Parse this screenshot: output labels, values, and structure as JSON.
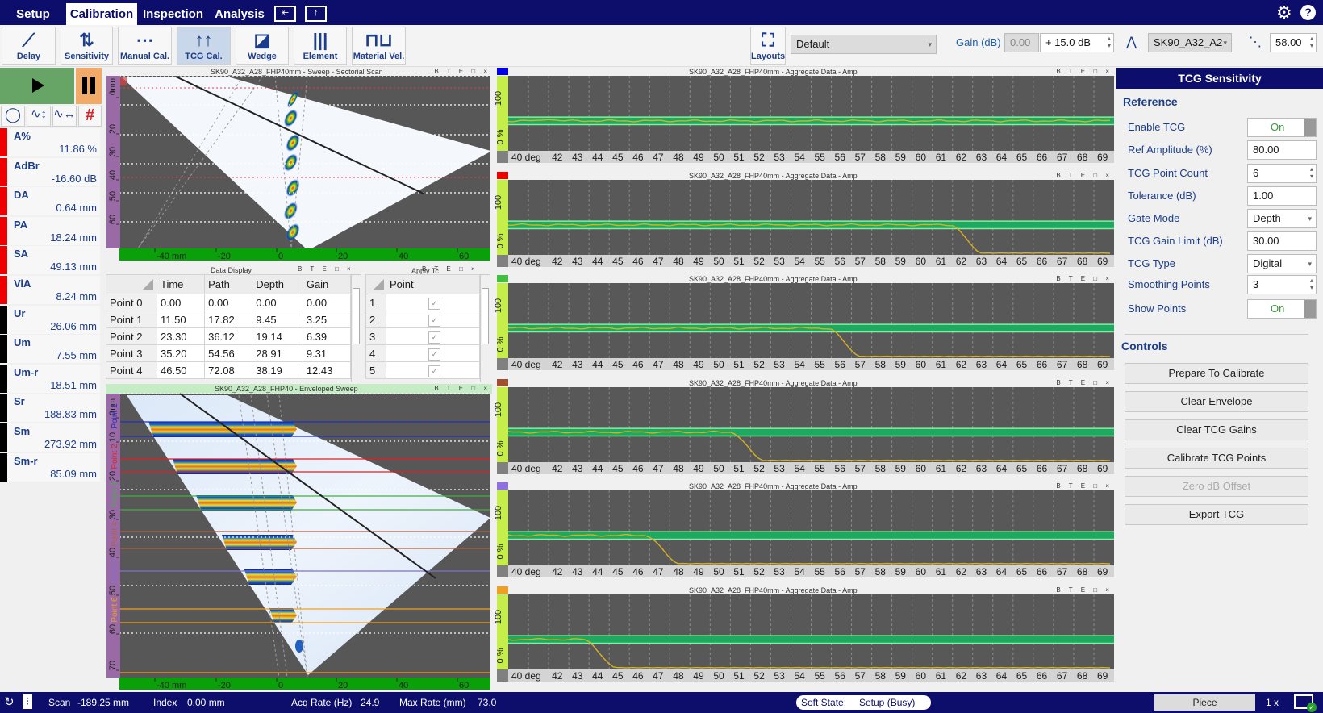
{
  "menu": {
    "tabs": [
      "Setup",
      "Calibration",
      "Inspection",
      "Analysis"
    ],
    "selected": "Calibration",
    "icons": [
      "panel-left-icon",
      "panel-up-icon"
    ]
  },
  "toolbar": {
    "buttons": [
      {
        "label": "Delay",
        "icon": "delay-icon"
      },
      {
        "label": "Sensitivity",
        "icon": "sensitivity-icon"
      },
      {
        "label": "Manual Cal.",
        "icon": "manual-cal-icon"
      },
      {
        "label": "TCG Cal.",
        "icon": "tcg-cal-icon",
        "selected": true
      },
      {
        "label": "Wedge",
        "icon": "wedge-icon"
      },
      {
        "label": "Element",
        "icon": "element-icon"
      },
      {
        "label": "Material Vel.",
        "icon": "material-vel-icon"
      }
    ],
    "layouts_label": "Layouts",
    "layout_value": "Default",
    "gain_label": "Gain (dB)",
    "gain_base": "0.00",
    "gain_offset": "+ 15.0 dB",
    "probe_value": "SK90_A32_A2",
    "angle_value": "58.00"
  },
  "readings": [
    {
      "name": "A%",
      "value": "11.86 %",
      "color": "#ee0000"
    },
    {
      "name": "AdBr",
      "value": "-16.60 dB",
      "color": "#ee0000"
    },
    {
      "name": "DA",
      "value": "0.64 mm",
      "color": "#ee0000"
    },
    {
      "name": "PA",
      "value": "18.24 mm",
      "color": "#ee0000"
    },
    {
      "name": "SA",
      "value": "49.13 mm",
      "color": "#ee0000"
    },
    {
      "name": "ViA",
      "value": "8.24 mm",
      "color": "#ee0000"
    },
    {
      "name": "Ur",
      "value": "26.06 mm",
      "color": "#000000"
    },
    {
      "name": "Um",
      "value": "7.55 mm",
      "color": "#000000"
    },
    {
      "name": "Um-r",
      "value": "-18.51 mm",
      "color": "#000000"
    },
    {
      "name": "Sr",
      "value": "188.83 mm",
      "color": "#000000"
    },
    {
      "name": "Sm",
      "value": "273.92 mm",
      "color": "#000000"
    },
    {
      "name": "Sm-r",
      "value": "85.09 mm",
      "color": "#000000"
    }
  ],
  "window_controls": "B T E □ ×",
  "sector_scan": {
    "title": "SK90_A32_A28_FHP40mm - Sweep - Sectorial Scan",
    "depth_unit": "mm",
    "depth_ticks": [
      "0",
      "20",
      "30",
      "40",
      "50",
      "60"
    ],
    "x_ticks": [
      "-40 mm",
      "-20",
      "0",
      "20",
      "40",
      "60"
    ]
  },
  "envelope_scan": {
    "title": "SK90_A32_A28_FHP40 - Enveloped Sweep",
    "depth_unit": "mm",
    "depth_ticks": [
      "0",
      "10",
      "20",
      "30",
      "40",
      "50",
      "60",
      "70"
    ],
    "x_ticks": [
      "-40 mm",
      "-20",
      "0",
      "20",
      "40",
      "60"
    ],
    "points": [
      {
        "label": "Point 1",
        "color": "#2030c0"
      },
      {
        "label": "Point 2",
        "color": "#e02020"
      },
      {
        "label": "Point 3",
        "color": "#40b040"
      },
      {
        "label": "Point 4",
        "color": "#b06040"
      },
      {
        "label": "Point 5",
        "color": "#8070d0"
      },
      {
        "label": "Point 6",
        "color": "#f0a020"
      }
    ]
  },
  "data_display": {
    "title": "Data Display",
    "columns": [
      "Time",
      "Path",
      "Depth",
      "Gain"
    ],
    "rows": [
      {
        "name": "Point 0",
        "values": [
          "0.00",
          "0.00",
          "0.00",
          "0.00"
        ]
      },
      {
        "name": "Point 1",
        "values": [
          "11.50",
          "17.82",
          "9.45",
          "3.25"
        ]
      },
      {
        "name": "Point 2",
        "values": [
          "23.30",
          "36.12",
          "19.14",
          "6.39"
        ]
      },
      {
        "name": "Point 3",
        "values": [
          "35.20",
          "54.56",
          "28.91",
          "9.31"
        ]
      },
      {
        "name": "Point 4",
        "values": [
          "46.50",
          "72.08",
          "38.19",
          "12.43"
        ]
      }
    ]
  },
  "apply_tcg": {
    "title": "Apply Tc",
    "column": "Point",
    "rows": [
      {
        "n": "1",
        "checked": true
      },
      {
        "n": "2",
        "checked": true
      },
      {
        "n": "3",
        "checked": true
      },
      {
        "n": "4",
        "checked": true
      },
      {
        "n": "5",
        "checked": true
      }
    ]
  },
  "a_scans": {
    "title": "SK90_A32_A28_FHP40mm - Aggregate Data - Amp",
    "y_top_label": "100",
    "y_bottom_label": "0 %",
    "x_first_label": "40 deg",
    "angle_range": [
      40,
      70
    ],
    "x_labels": [
      42,
      43,
      44,
      45,
      46,
      47,
      48,
      49,
      50,
      51,
      52,
      53,
      54,
      55,
      56,
      57,
      58,
      59,
      60,
      61,
      62,
      63,
      64,
      65,
      66,
      67,
      68,
      69
    ],
    "band_percent": [
      35,
      45
    ],
    "plateau_percent": 40,
    "floor_percent": 2,
    "plots": [
      {
        "color": "#0000ee",
        "drop_start": null,
        "drop_end": null
      },
      {
        "color": "#ee0000",
        "drop_start": 61.9,
        "drop_end": 63.5
      },
      {
        "color": "#40c040",
        "drop_start": 55.8,
        "drop_end": 57.5
      },
      {
        "color": "#a05030",
        "drop_start": 51.0,
        "drop_end": 52.7
      },
      {
        "color": "#9070e0",
        "drop_start": 46.8,
        "drop_end": 48.5
      },
      {
        "color": "#f0a020",
        "drop_start": 43.7,
        "drop_end": 45.4
      }
    ]
  },
  "tcg_panel": {
    "title": "TCG Sensitivity",
    "reference_header": "Reference",
    "fields": [
      {
        "label": "Enable TCG",
        "type": "toggle",
        "value": "On"
      },
      {
        "label": "Ref Amplitude (%)",
        "type": "text",
        "value": "80.00"
      },
      {
        "label": "TCG Point Count",
        "type": "spin",
        "value": "6"
      },
      {
        "label": "Tolerance (dB)",
        "type": "text",
        "value": "1.00"
      },
      {
        "label": "Gate Mode",
        "type": "select",
        "value": "Depth"
      },
      {
        "label": "TCG Gain Limit (dB)",
        "type": "text",
        "value": "30.00"
      },
      {
        "label": "TCG Type",
        "type": "select",
        "value": "Digital"
      },
      {
        "label": "Smoothing Points",
        "type": "spin",
        "value": "3"
      },
      {
        "label": "Show Points",
        "type": "toggle",
        "value": "On"
      }
    ],
    "controls_header": "Controls",
    "buttons": [
      {
        "label": "Prepare To Calibrate",
        "enabled": true
      },
      {
        "label": "Clear Envelope",
        "enabled": true
      },
      {
        "label": "Clear TCG Gains",
        "enabled": true
      },
      {
        "label": "Calibrate TCG Points",
        "enabled": true
      },
      {
        "label": "Zero dB Offset",
        "enabled": false
      },
      {
        "label": "Export TCG",
        "enabled": true
      }
    ]
  },
  "status": {
    "scan_label": "Scan",
    "scan_value": "-189.25 mm",
    "index_label": "Index",
    "index_value": "0.00 mm",
    "acq_label": "Acq Rate (Hz)",
    "acq_value": "24.9",
    "max_label": "Max Rate (mm)",
    "max_value": "73.0",
    "soft_state_label": "Soft State:",
    "soft_state_value": "Setup (Busy)",
    "piece": "Piece",
    "multiplier": "1 x"
  }
}
